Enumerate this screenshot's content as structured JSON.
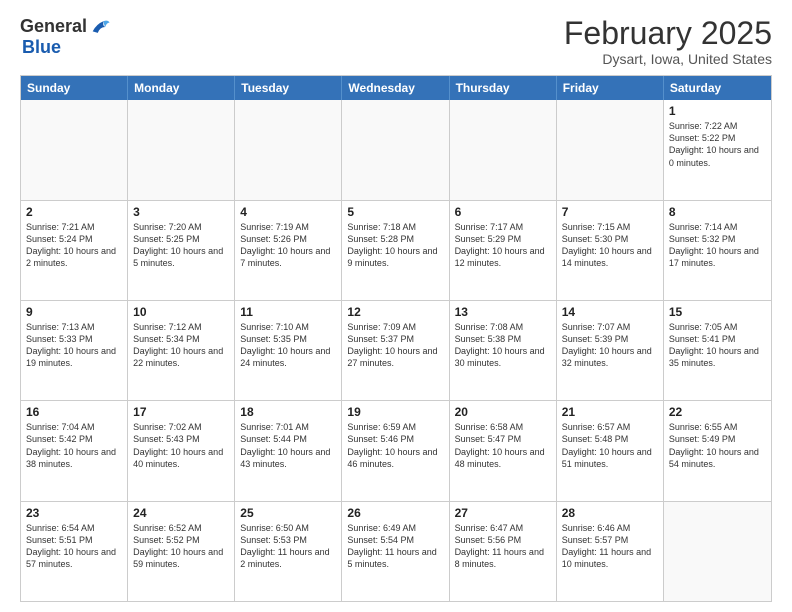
{
  "header": {
    "logo": {
      "line1": "General",
      "line2": "Blue"
    },
    "title": "February 2025",
    "subtitle": "Dysart, Iowa, United States"
  },
  "days_of_week": [
    "Sunday",
    "Monday",
    "Tuesday",
    "Wednesday",
    "Thursday",
    "Friday",
    "Saturday"
  ],
  "weeks": [
    [
      {
        "day": "",
        "empty": true
      },
      {
        "day": "",
        "empty": true
      },
      {
        "day": "",
        "empty": true
      },
      {
        "day": "",
        "empty": true
      },
      {
        "day": "",
        "empty": true
      },
      {
        "day": "",
        "empty": true
      },
      {
        "day": "1",
        "sunrise": "7:22 AM",
        "sunset": "5:22 PM",
        "daylight": "10 hours and 0 minutes."
      }
    ],
    [
      {
        "day": "2",
        "sunrise": "7:21 AM",
        "sunset": "5:24 PM",
        "daylight": "10 hours and 2 minutes."
      },
      {
        "day": "3",
        "sunrise": "7:20 AM",
        "sunset": "5:25 PM",
        "daylight": "10 hours and 5 minutes."
      },
      {
        "day": "4",
        "sunrise": "7:19 AM",
        "sunset": "5:26 PM",
        "daylight": "10 hours and 7 minutes."
      },
      {
        "day": "5",
        "sunrise": "7:18 AM",
        "sunset": "5:28 PM",
        "daylight": "10 hours and 9 minutes."
      },
      {
        "day": "6",
        "sunrise": "7:17 AM",
        "sunset": "5:29 PM",
        "daylight": "10 hours and 12 minutes."
      },
      {
        "day": "7",
        "sunrise": "7:15 AM",
        "sunset": "5:30 PM",
        "daylight": "10 hours and 14 minutes."
      },
      {
        "day": "8",
        "sunrise": "7:14 AM",
        "sunset": "5:32 PM",
        "daylight": "10 hours and 17 minutes."
      }
    ],
    [
      {
        "day": "9",
        "sunrise": "7:13 AM",
        "sunset": "5:33 PM",
        "daylight": "10 hours and 19 minutes."
      },
      {
        "day": "10",
        "sunrise": "7:12 AM",
        "sunset": "5:34 PM",
        "daylight": "10 hours and 22 minutes."
      },
      {
        "day": "11",
        "sunrise": "7:10 AM",
        "sunset": "5:35 PM",
        "daylight": "10 hours and 24 minutes."
      },
      {
        "day": "12",
        "sunrise": "7:09 AM",
        "sunset": "5:37 PM",
        "daylight": "10 hours and 27 minutes."
      },
      {
        "day": "13",
        "sunrise": "7:08 AM",
        "sunset": "5:38 PM",
        "daylight": "10 hours and 30 minutes."
      },
      {
        "day": "14",
        "sunrise": "7:07 AM",
        "sunset": "5:39 PM",
        "daylight": "10 hours and 32 minutes."
      },
      {
        "day": "15",
        "sunrise": "7:05 AM",
        "sunset": "5:41 PM",
        "daylight": "10 hours and 35 minutes."
      }
    ],
    [
      {
        "day": "16",
        "sunrise": "7:04 AM",
        "sunset": "5:42 PM",
        "daylight": "10 hours and 38 minutes."
      },
      {
        "day": "17",
        "sunrise": "7:02 AM",
        "sunset": "5:43 PM",
        "daylight": "10 hours and 40 minutes."
      },
      {
        "day": "18",
        "sunrise": "7:01 AM",
        "sunset": "5:44 PM",
        "daylight": "10 hours and 43 minutes."
      },
      {
        "day": "19",
        "sunrise": "6:59 AM",
        "sunset": "5:46 PM",
        "daylight": "10 hours and 46 minutes."
      },
      {
        "day": "20",
        "sunrise": "6:58 AM",
        "sunset": "5:47 PM",
        "daylight": "10 hours and 48 minutes."
      },
      {
        "day": "21",
        "sunrise": "6:57 AM",
        "sunset": "5:48 PM",
        "daylight": "10 hours and 51 minutes."
      },
      {
        "day": "22",
        "sunrise": "6:55 AM",
        "sunset": "5:49 PM",
        "daylight": "10 hours and 54 minutes."
      }
    ],
    [
      {
        "day": "23",
        "sunrise": "6:54 AM",
        "sunset": "5:51 PM",
        "daylight": "10 hours and 57 minutes."
      },
      {
        "day": "24",
        "sunrise": "6:52 AM",
        "sunset": "5:52 PM",
        "daylight": "10 hours and 59 minutes."
      },
      {
        "day": "25",
        "sunrise": "6:50 AM",
        "sunset": "5:53 PM",
        "daylight": "11 hours and 2 minutes."
      },
      {
        "day": "26",
        "sunrise": "6:49 AM",
        "sunset": "5:54 PM",
        "daylight": "11 hours and 5 minutes."
      },
      {
        "day": "27",
        "sunrise": "6:47 AM",
        "sunset": "5:56 PM",
        "daylight": "11 hours and 8 minutes."
      },
      {
        "day": "28",
        "sunrise": "6:46 AM",
        "sunset": "5:57 PM",
        "daylight": "11 hours and 10 minutes."
      },
      {
        "day": "",
        "empty": true
      }
    ]
  ]
}
